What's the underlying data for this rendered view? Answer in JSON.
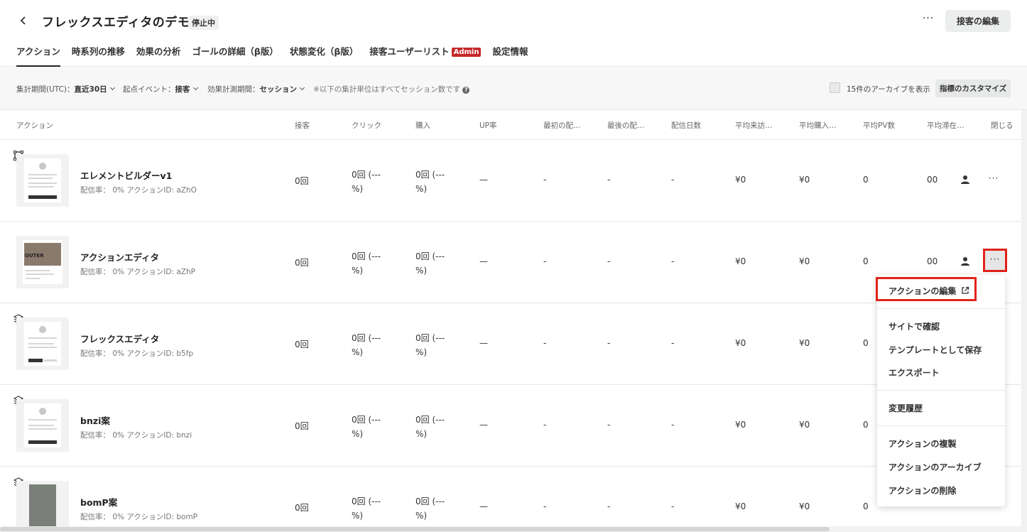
{
  "header": {
    "title": "フレックスエディタのデモ",
    "status": "停止中",
    "more_label": "···",
    "edit_button": "接客の編集"
  },
  "tabs": [
    {
      "label": "アクション",
      "active": true
    },
    {
      "label": "時系列の推移"
    },
    {
      "label": "効果の分析"
    },
    {
      "label": "ゴールの詳細（β版）"
    },
    {
      "label": "状態変化（β版）"
    },
    {
      "label": "接客ユーザーリスト",
      "badge": "Admin"
    },
    {
      "label": "設定情報"
    }
  ],
  "filters": {
    "period_label": "集計期間(UTC)：",
    "period_value": "直近30日",
    "event_label": "起点イベント：",
    "event_value": "接客",
    "measure_label": "効果計測期間：",
    "measure_value": "セッション",
    "note": "※以下の集計単位はすべてセッション数です",
    "archive_label": "15件のアーカイブを表示",
    "customize_button": "指標のカスタマイズ"
  },
  "columns": [
    "アクション",
    "接客",
    "クリック",
    "購入",
    "UP率",
    "最初の配…",
    "最後の配…",
    "配信日数",
    "平均来訪…",
    "平均購入…",
    "平均PV数",
    "平均滞在…",
    "閉じる"
  ],
  "rows": [
    {
      "name": "エレメントビルダーv1",
      "meta": "配信率： 0% アクションID: aZhO",
      "icon": "frame-icon",
      "c1": "0回",
      "c2a": "0回 (---",
      "c2b": "%)",
      "c3a": "0回 (---",
      "c3b": "%)",
      "c4": "—",
      "c5": "-",
      "c6": "-",
      "c7": "-",
      "c8": "¥0",
      "c9": "¥0",
      "c10": "0",
      "c11": "00"
    },
    {
      "name": "アクションエディタ",
      "meta": "配信率： 0% アクションID: aZhP",
      "icon": "",
      "c1": "0回",
      "c2a": "0回 (---",
      "c2b": "%)",
      "c3a": "0回 (---",
      "c3b": "%)",
      "c4": "—",
      "c5": "-",
      "c6": "-",
      "c7": "-",
      "c8": "¥0",
      "c9": "¥0",
      "c10": "0",
      "c11": "00"
    },
    {
      "name": "フレックスエディタ",
      "meta": "配信率： 0% アクションID: b5fp",
      "icon": "layers-icon",
      "c1": "0回",
      "c2a": "0回 (---",
      "c2b": "%)",
      "c3a": "0回 (---",
      "c3b": "%)",
      "c4": "—",
      "c5": "-",
      "c6": "-",
      "c7": "-",
      "c8": "¥0",
      "c9": "¥0",
      "c10": "0",
      "c11": ""
    },
    {
      "name": "bnzi案",
      "meta": "配信率： 0% アクションID: bnzi",
      "icon": "layers-icon",
      "c1": "0回",
      "c2a": "0回 (---",
      "c2b": "%)",
      "c3a": "0回 (---",
      "c3b": "%)",
      "c4": "—",
      "c5": "-",
      "c6": "-",
      "c7": "-",
      "c8": "¥0",
      "c9": "¥0",
      "c10": "0",
      "c11": ""
    },
    {
      "name": "bomP案",
      "meta": "配信率： 0% アクションID: bomP",
      "icon": "layers-icon",
      "c1": "0回",
      "c2a": "0回 (---",
      "c2b": "%)",
      "c3a": "0回 (---",
      "c3b": "%)",
      "c4": "—",
      "c5": "-",
      "c6": "-",
      "c7": "-",
      "c8": "¥0",
      "c9": "¥0",
      "c10": "0",
      "c11": ""
    }
  ],
  "thumb_text": {
    "outer": "OUTER"
  },
  "menu": {
    "edit": "アクションの編集",
    "site_check": "サイトで確認",
    "save_template": "テンプレートとして保存",
    "export": "エクスポート",
    "history": "変更履歴",
    "duplicate": "アクションの複製",
    "archive": "アクションのアーカイブ",
    "delete": "アクションの削除"
  },
  "colors": {
    "highlight": "#e0231b",
    "admin": "#c62828"
  }
}
